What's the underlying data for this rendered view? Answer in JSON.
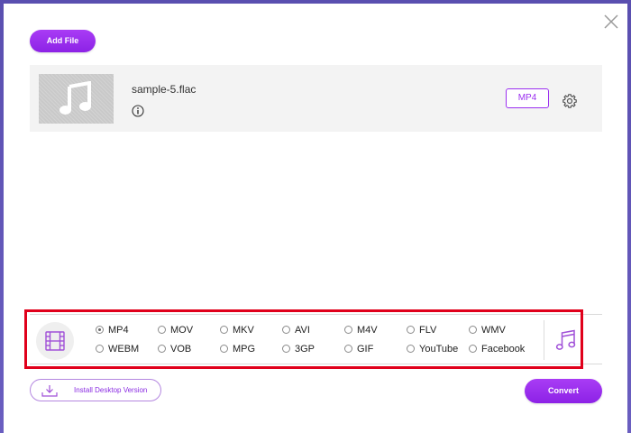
{
  "toolbar": {
    "add_file_label": "Add File"
  },
  "file": {
    "name": "sample-5.flac",
    "format_badge": "MP4"
  },
  "formats": {
    "selected": "MP4",
    "options": [
      {
        "label": "MP4",
        "checked": true
      },
      {
        "label": "MOV",
        "checked": false
      },
      {
        "label": "MKV",
        "checked": false
      },
      {
        "label": "AVI",
        "checked": false
      },
      {
        "label": "M4V",
        "checked": false
      },
      {
        "label": "FLV",
        "checked": false
      },
      {
        "label": "WMV",
        "checked": false
      },
      {
        "label": "WEBM",
        "checked": false
      },
      {
        "label": "VOB",
        "checked": false
      },
      {
        "label": "MPG",
        "checked": false
      },
      {
        "label": "3GP",
        "checked": false
      },
      {
        "label": "GIF",
        "checked": false
      },
      {
        "label": "YouTube",
        "checked": false
      },
      {
        "label": "Facebook",
        "checked": false
      }
    ]
  },
  "footer": {
    "install_label": "Install Desktop Version",
    "convert_label": "Convert"
  },
  "colors": {
    "accent": "#9b2ff0",
    "highlight": "#e0001b",
    "backdrop": "#5a4fb0"
  },
  "icons": {
    "close": "close-icon",
    "music_note": "music-note-icon",
    "info": "info-icon",
    "gear": "gear-icon",
    "video_tab": "film-icon",
    "audio_tab": "music-note-icon",
    "download": "download-icon"
  }
}
